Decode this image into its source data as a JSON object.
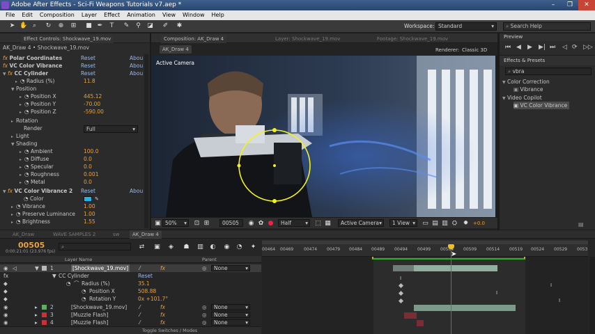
{
  "window": {
    "title": "Adobe After Effects - Sci-Fi Weapons Tutorials v7.aep *",
    "controls": [
      "–",
      "❐",
      "✕"
    ]
  },
  "menu": [
    "File",
    "Edit",
    "Composition",
    "Layer",
    "Effect",
    "Animation",
    "View",
    "Window",
    "Help"
  ],
  "toolbar": {
    "workspace_label": "Workspace:",
    "workspace_value": "Standard",
    "search_placeholder": "Search Help"
  },
  "effect_controls": {
    "tab": "Effect Controls: Shockwave_19.mov",
    "subtitle": "AK_Draw 4 • Shockwave_19.mov",
    "effects": [
      {
        "name": "Polar Coordinates",
        "reset": "Reset",
        "about": "Abou"
      },
      {
        "name": "VC Color Vibrance",
        "reset": "Reset",
        "about": "Abou"
      },
      {
        "name": "CC Cylinder",
        "reset": "Reset",
        "about": "Abou"
      }
    ],
    "props": {
      "radius": {
        "label": "Radius (%)",
        "value": "11.8"
      },
      "position": "Position",
      "position_x": {
        "label": "Position X",
        "value": "445.12"
      },
      "position_y": {
        "label": "Position Y",
        "value": "-70.00"
      },
      "position_z": {
        "label": "Position Z",
        "value": "-590.00"
      },
      "rotation": "Rotation",
      "render": {
        "label": "Render",
        "value": "Full"
      },
      "light": "Light",
      "shading": "Shading",
      "ambient": {
        "label": "Ambient",
        "value": "100.0"
      },
      "diffuse": {
        "label": "Diffuse",
        "value": "0.0"
      },
      "specular": {
        "label": "Specular",
        "value": "0.0"
      },
      "roughness": {
        "label": "Roughness",
        "value": "0.001"
      },
      "metal": {
        "label": "Metal",
        "value": "0.0"
      },
      "vc2": {
        "name": "VC Color Vibrance 2",
        "reset": "Reset",
        "about": "Abou"
      },
      "color": "Color",
      "vibrance": {
        "label": "Vibrance",
        "value": "1.00"
      },
      "preserve": {
        "label": "Preserve Luminance",
        "value": "1.00"
      },
      "brightness": {
        "label": "Brightness",
        "value": "1.55"
      }
    }
  },
  "composition": {
    "tab": "Composition: AK_Draw 4",
    "layer_tab": "Layer: Shockwave_19.mov",
    "footage_tab": "Footage: Shockwave_19.mov",
    "subtab": "AK_Draw 4",
    "renderer_label": "Renderer:",
    "renderer_value": "Classic 3D",
    "camera_label": "Active Camera",
    "footer": {
      "zoom": "50%",
      "timecode": "00505",
      "resolution": "Half",
      "camera": "Active Camera",
      "view": "1 View",
      "exposure": "+0.0"
    }
  },
  "preview": {
    "title": "Preview"
  },
  "effects_presets": {
    "title": "Effects & Presets",
    "search_value": "vbra",
    "tree": [
      {
        "label": "Color Correction",
        "level": 0
      },
      {
        "label": "Vibrance",
        "level": 1
      },
      {
        "label": "Video Copilot",
        "level": 0
      },
      {
        "label": "VC Color Vibrance",
        "level": 1
      }
    ]
  },
  "timeline": {
    "tabs": [
      "AK_Draw",
      "WAVE SAMPLES 2",
      "sw",
      "AK_Draw 4"
    ],
    "timecode": "00505",
    "timecode_sub": "0:00:21:01 (23.976 fps)",
    "header_layer": "Layer Name",
    "header_parent": "Parent",
    "ruler": [
      "00464",
      "00469",
      "00474",
      "00479",
      "00484",
      "00489",
      "00494",
      "00499",
      "00504",
      "00509",
      "00514",
      "00519",
      "00524",
      "00529",
      "0053"
    ],
    "layers": [
      {
        "num": "1",
        "name": "[Shockwave_19.mov]",
        "parent": "None",
        "color": "#b8b8b8"
      },
      {
        "num": "2",
        "name": "[Shockwave_19.mov]",
        "parent": "None",
        "color": "#67a867"
      },
      {
        "num": "3",
        "name": "[Muzzle Flash]",
        "parent": "None",
        "color": "#c0343e"
      },
      {
        "num": "4",
        "name": "[Muzzle Flash]",
        "parent": "None",
        "color": "#c0343e"
      }
    ],
    "sub": {
      "effect": "CC Cylinder",
      "reset": "Reset",
      "radius": {
        "label": "Radius (%)",
        "value": "35.1"
      },
      "position_x": {
        "label": "Position X",
        "value": "508.88"
      },
      "rotation_y": {
        "label": "Rotation Y",
        "value": "0x +101.7°"
      }
    },
    "footer": "Toggle Switches / Modes"
  }
}
